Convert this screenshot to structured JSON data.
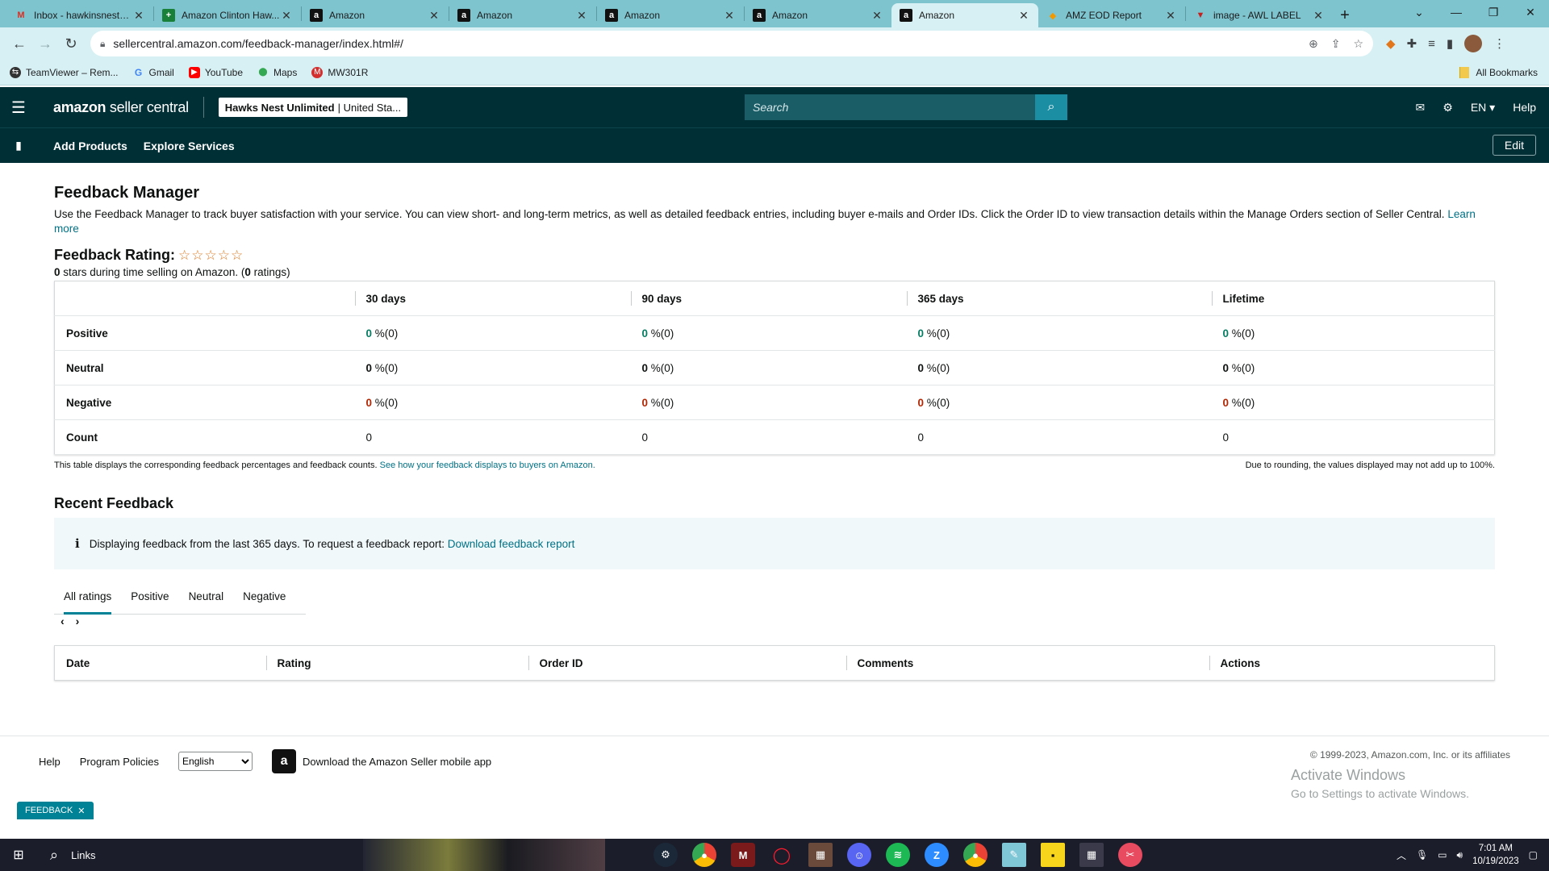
{
  "browser": {
    "tabs": [
      {
        "title": "Inbox - hawkinsnest2...",
        "icon": "gmail-icon"
      },
      {
        "title": "Amazon Clinton Haw...",
        "icon": "sheets-icon"
      },
      {
        "title": "Amazon",
        "icon": "amazon-icon"
      },
      {
        "title": "Amazon",
        "icon": "amazon-icon"
      },
      {
        "title": "Amazon",
        "icon": "amazon-icon"
      },
      {
        "title": "Amazon",
        "icon": "amazon-icon"
      },
      {
        "title": "Amazon",
        "icon": "amazon-icon",
        "active": true
      },
      {
        "title": "AMZ EOD Report",
        "icon": "drive-icon"
      },
      {
        "title": "image - AWL LABEL",
        "icon": "vivaldi-icon"
      }
    ],
    "url": "sellercentral.amazon.com/feedback-manager/index.html#/",
    "bookmarks": [
      {
        "label": "TeamViewer – Rem...",
        "icon": "teamviewer-icon"
      },
      {
        "label": "Gmail",
        "icon": "google-icon"
      },
      {
        "label": "YouTube",
        "icon": "youtube-icon"
      },
      {
        "label": "Maps",
        "icon": "maps-icon"
      },
      {
        "label": "MW301R",
        "icon": "mercusys-icon"
      }
    ],
    "all_bookmarks": "All Bookmarks"
  },
  "header": {
    "logo_amazon": "amazon",
    "logo_seller": "seller central",
    "account_name": "Hawks Nest Unlimited",
    "account_region": "| United Sta...",
    "search_placeholder": "Search",
    "language": "EN",
    "help": "Help"
  },
  "subnav": {
    "items": [
      "Add Products",
      "Explore Services"
    ],
    "edit": "Edit"
  },
  "page": {
    "title": "Feedback Manager",
    "intro": "Use the Feedback Manager to track buyer satisfaction with your service. You can view short- and long-term metrics, as well as detailed feedback entries, including buyer e-mails and Order IDs. Click the Order ID to view transaction details within the Manage Orders section of Seller Central.",
    "learn_more": "Learn more",
    "rating_title": "Feedback Rating:",
    "stars": "☆☆☆☆☆",
    "stars_value": "0",
    "stars_text": " stars during time selling on Amazon. (",
    "ratings_count": "0",
    "ratings_text": " ratings)",
    "metrics": {
      "columns": [
        "30 days",
        "90 days",
        "365 days",
        "Lifetime"
      ],
      "rows": [
        {
          "label": "Positive",
          "kind": "pos",
          "cells": [
            "0",
            "0",
            "0",
            "0"
          ],
          "suffix": "%(0)"
        },
        {
          "label": "Neutral",
          "kind": "neu",
          "cells": [
            "0",
            "0",
            "0",
            "0"
          ],
          "suffix": "%(0)"
        },
        {
          "label": "Negative",
          "kind": "neg",
          "cells": [
            "0",
            "0",
            "0",
            "0"
          ],
          "suffix": "%(0)"
        },
        {
          "label": "Count",
          "kind": "count",
          "cells": [
            "0",
            "0",
            "0",
            "0"
          ],
          "suffix": ""
        }
      ]
    },
    "table_note": "This table displays the corresponding feedback percentages and feedback counts.",
    "table_note_link": "See how your feedback displays to buyers on Amazon.",
    "rounding_note": "Due to rounding, the values displayed may not add up to 100%.",
    "recent_title": "Recent Feedback",
    "info_text": "Displaying feedback from the last 365 days. To request a feedback report:",
    "info_link": "Download feedback report",
    "filter_tabs": [
      "All ratings",
      "Positive",
      "Neutral",
      "Negative"
    ],
    "feedback_columns": [
      "Date",
      "Rating",
      "Order ID",
      "Comments",
      "Actions"
    ]
  },
  "footer": {
    "help": "Help",
    "program_policies": "Program Policies",
    "language_selected": "English",
    "mobile_app": "Download the Amazon Seller mobile app",
    "copyright": "© 1999-2023, Amazon.com, Inc. or its affiliates",
    "activate_title": "Activate Windows",
    "activate_sub": "Go to Settings to activate Windows.",
    "feedback_tab": "FEEDBACK"
  },
  "taskbar": {
    "search_label": "Links",
    "time": "7:01 AM",
    "date": "10/19/2023"
  },
  "colors": {
    "amazon_header": "#002f36",
    "link": "#007185",
    "positive": "#067d62",
    "negative": "#b12704",
    "chrome_tabstrip": "#7ec4cf"
  }
}
